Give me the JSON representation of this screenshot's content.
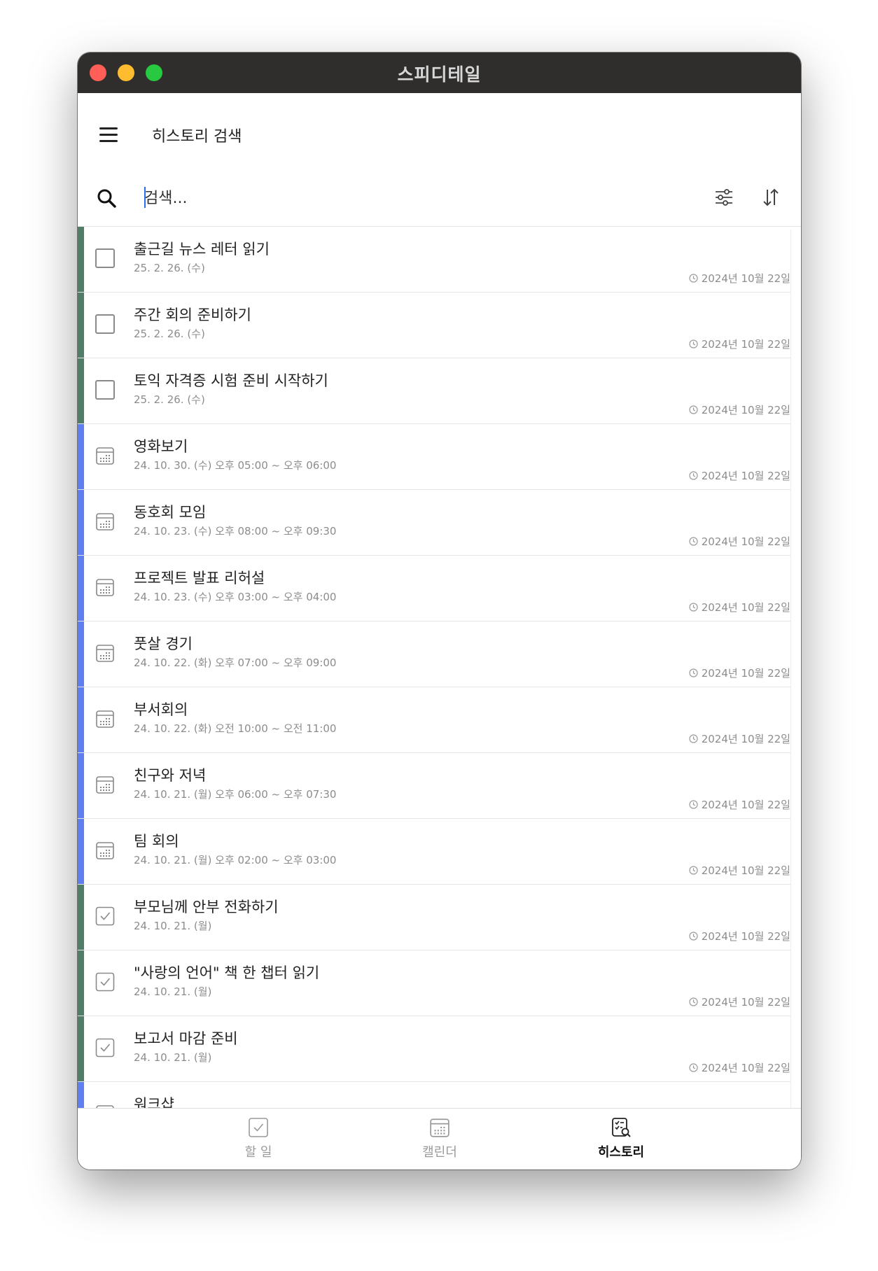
{
  "window": {
    "title": "스피디테일"
  },
  "header": {
    "title": "히스토리 검색"
  },
  "search": {
    "placeholder": "검색..."
  },
  "colors": {
    "todo_bar": "#4f7d67",
    "event_bar": "#5d7ff2"
  },
  "items": [
    {
      "kind": "todo",
      "done": false,
      "icon": "checkbox-icon",
      "title": "출근길 뉴스 레터 읽기",
      "date": "25. 2. 26. (수)",
      "stamp": "2024년 10월 22일"
    },
    {
      "kind": "todo",
      "done": false,
      "icon": "checkbox-icon",
      "title": "주간 회의 준비하기",
      "date": "25. 2. 26. (수)",
      "stamp": "2024년 10월 22일"
    },
    {
      "kind": "todo",
      "done": false,
      "icon": "checkbox-icon",
      "title": "토익 자격증 시험 준비 시작하기",
      "date": "25. 2. 26. (수)",
      "stamp": "2024년 10월 22일"
    },
    {
      "kind": "event",
      "icon": "calendar-icon",
      "title": "영화보기",
      "date": "24. 10. 30. (수) 오후 05:00 ~ 오후 06:00",
      "stamp": "2024년 10월 22일"
    },
    {
      "kind": "event",
      "icon": "calendar-icon",
      "title": "동호회 모임",
      "date": "24. 10. 23. (수) 오후 08:00 ~ 오후 09:30",
      "stamp": "2024년 10월 22일"
    },
    {
      "kind": "event",
      "icon": "calendar-icon",
      "title": "프로젝트 발표 리허설",
      "date": "24. 10. 23. (수) 오후 03:00 ~ 오후 04:00",
      "stamp": "2024년 10월 22일"
    },
    {
      "kind": "event",
      "icon": "calendar-icon",
      "title": "풋살 경기",
      "date": "24. 10. 22. (화) 오후 07:00 ~ 오후 09:00",
      "stamp": "2024년 10월 22일"
    },
    {
      "kind": "event",
      "icon": "calendar-icon",
      "title": "부서회의",
      "date": "24. 10. 22. (화) 오전 10:00 ~ 오전 11:00",
      "stamp": "2024년 10월 22일"
    },
    {
      "kind": "event",
      "icon": "calendar-icon",
      "title": "친구와 저녁",
      "date": "24. 10. 21. (월) 오후 06:00 ~ 오후 07:30",
      "stamp": "2024년 10월 22일"
    },
    {
      "kind": "event",
      "icon": "calendar-icon",
      "title": "팀 회의",
      "date": "24. 10. 21. (월) 오후 02:00 ~ 오후 03:00",
      "stamp": "2024년 10월 22일"
    },
    {
      "kind": "todo",
      "done": true,
      "icon": "checked-checkbox-icon",
      "title": "부모님께 안부 전화하기",
      "date": "24. 10. 21. (월)",
      "stamp": "2024년 10월 22일"
    },
    {
      "kind": "todo",
      "done": true,
      "icon": "checked-checkbox-icon",
      "title": "\"사랑의 언어\" 책 한 챕터 읽기",
      "date": "24. 10. 21. (월)",
      "stamp": "2024년 10월 22일"
    },
    {
      "kind": "todo",
      "done": true,
      "icon": "checked-checkbox-icon",
      "title": "보고서 마감 준비",
      "date": "24. 10. 21. (월)",
      "stamp": "2024년 10월 22일"
    },
    {
      "kind": "event",
      "icon": "calendar-icon",
      "title": "워크샵",
      "date": "",
      "stamp": ""
    }
  ],
  "tabs": [
    {
      "label": "할 일",
      "icon": "todo-tab-icon",
      "active": false
    },
    {
      "label": "캘린더",
      "icon": "calendar-tab-icon",
      "active": false
    },
    {
      "label": "히스토리",
      "icon": "history-tab-icon",
      "active": true
    }
  ]
}
